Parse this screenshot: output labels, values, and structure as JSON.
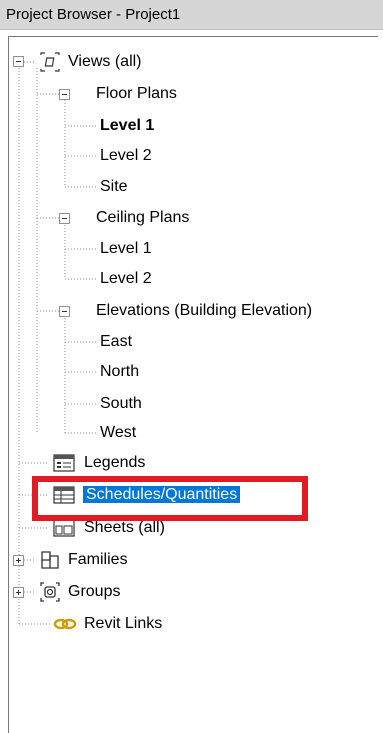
{
  "window": {
    "title": "Project Browser - Project1"
  },
  "tree": {
    "views": {
      "label": "Views (all)",
      "floor_plans": {
        "label": "Floor Plans",
        "items": [
          "Level 1",
          "Level 2",
          "Site"
        ]
      },
      "ceiling_plans": {
        "label": "Ceiling Plans",
        "items": [
          "Level 1",
          "Level 2"
        ]
      },
      "elevations": {
        "label": "Elevations (Building Elevation)",
        "items": [
          "East",
          "North",
          "South",
          "West"
        ]
      }
    },
    "legends": {
      "label": "Legends"
    },
    "schedules": {
      "label": "Schedules/Quantities"
    },
    "sheets": {
      "label": "Sheets (all)"
    },
    "families": {
      "label": "Families"
    },
    "groups": {
      "label": "Groups"
    },
    "revit_links": {
      "label": "Revit Links"
    }
  },
  "state": {
    "selected": "Schedules/Quantities",
    "active_view": "Level 1"
  },
  "colors": {
    "selection": "#0078d7",
    "annotation_box": "#e01b24",
    "title_bar": "#d6d6d6"
  },
  "icons": {
    "views": "views-icon",
    "legends": "legends-icon",
    "schedules": "schedule-icon",
    "sheets": "sheets-icon",
    "families": "families-icon",
    "groups": "groups-icon",
    "revit_links": "link-chain-icon"
  }
}
